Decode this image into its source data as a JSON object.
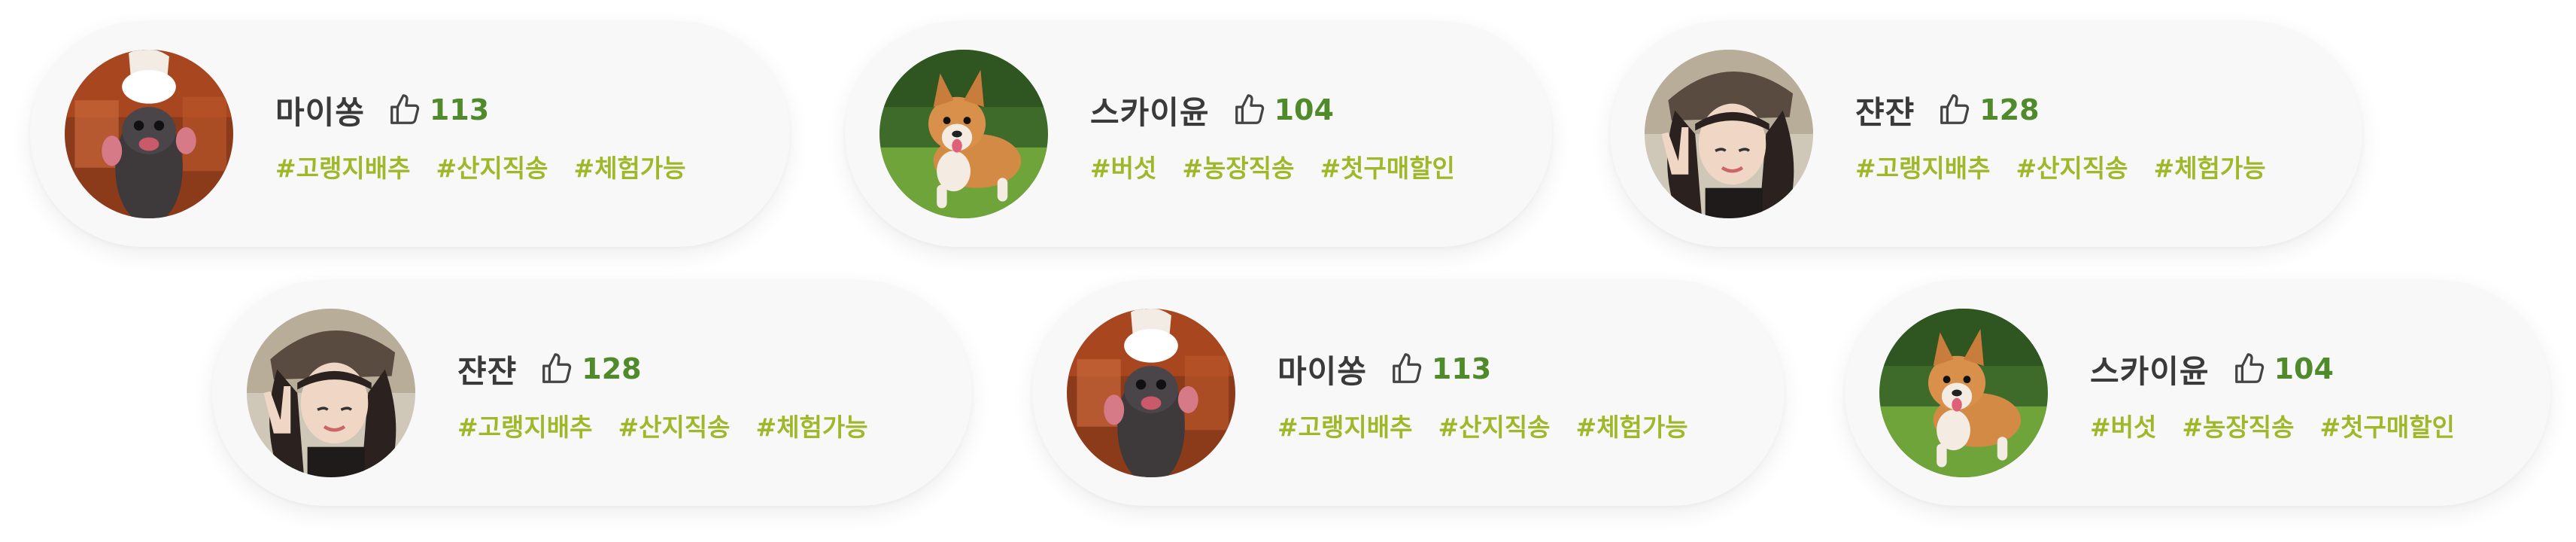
{
  "cards": [
    {
      "name": "마이쏭",
      "likes": "113",
      "avatar_type": "rat-chef-photo",
      "tags": [
        "#고랭지배추",
        "#산지직송",
        "#체험가능"
      ]
    },
    {
      "name": "스카이윤",
      "likes": "104",
      "avatar_type": "corgi-photo",
      "tags": [
        "#버섯",
        "#농장직송",
        "#첫구매할인"
      ]
    },
    {
      "name": "쟌쟌",
      "likes": "128",
      "avatar_type": "woman-photo",
      "tags": [
        "#고랭지배추",
        "#산지직송",
        "#체험가능"
      ]
    },
    {
      "name": "쟌쟌",
      "likes": "128",
      "avatar_type": "woman-photo",
      "tags": [
        "#고랭지배추",
        "#산지직송",
        "#체험가능"
      ]
    },
    {
      "name": "마이쏭",
      "likes": "113",
      "avatar_type": "rat-chef-photo",
      "tags": [
        "#고랭지배추",
        "#산지직송",
        "#체험가능"
      ]
    },
    {
      "name": "스카이윤",
      "likes": "104",
      "avatar_type": "corgi-photo",
      "tags": [
        "#버섯",
        "#농장직송",
        "#첫구매할인"
      ]
    }
  ],
  "like_icon": "thumbs-up-icon",
  "colors": {
    "name": "#3a3a3a",
    "likes": "#4f8a2b",
    "tag": "#9fb82a",
    "card_bg": "#f8f8f8"
  }
}
